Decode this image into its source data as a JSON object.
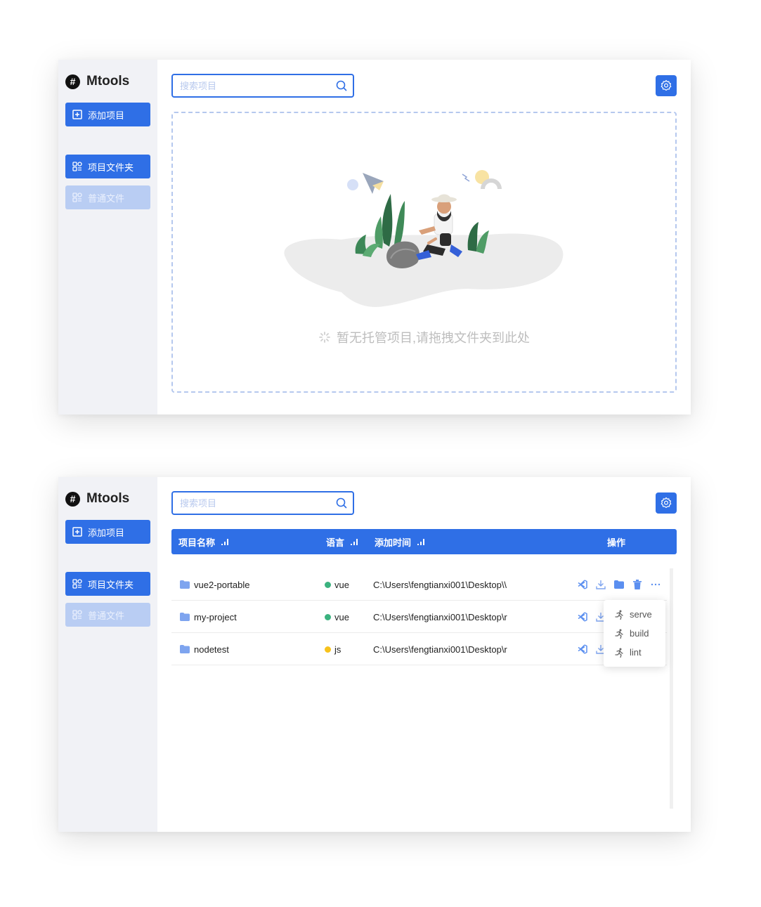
{
  "app": {
    "title": "Mtools",
    "add_project": "添加项目",
    "nav": {
      "project_folder": "项目文件夹",
      "normal_files": "普通文件"
    },
    "search_placeholder": "搜索项目"
  },
  "empty_state": {
    "message": "暂无托管项目,请拖拽文件夹到此处"
  },
  "table": {
    "headers": {
      "name": "项目名称",
      "lang": "语言",
      "time": "添加时间",
      "ops": "操作"
    },
    "rows": [
      {
        "name": "vue2-portable",
        "lang": "vue",
        "lang_color": "#3bb27f",
        "path": "C:\\Users\\fengtianxi001\\Desktop\\\\"
      },
      {
        "name": "my-project",
        "lang": "vue",
        "lang_color": "#3bb27f",
        "path": "C:\\Users\\fengtianxi001\\Desktop\\r"
      },
      {
        "name": "nodetest",
        "lang": "js",
        "lang_color": "#f7c21c",
        "path": "C:\\Users\\fengtianxi001\\Desktop\\r"
      }
    ]
  },
  "script_menu": {
    "items": [
      "serve",
      "build",
      "lint"
    ]
  },
  "icons": {
    "logo": "hash-icon",
    "add": "plus-square-icon",
    "nav": "grid-icon",
    "search": "search-icon",
    "settings": "gear-icon",
    "sort": "sort-bars-icon",
    "folder": "folder-icon",
    "vscode": "vscode-icon",
    "download": "download-icon",
    "open_folder": "folder-icon",
    "delete": "trash-icon",
    "more": "ellipsis-icon",
    "run": "run-icon",
    "loading": "spinner-icon"
  },
  "colors": {
    "primary": "#2f6fe6",
    "sidebar_bg": "#f1f2f6",
    "disabled_nav": "#b9cdf3",
    "vue": "#3bb27f",
    "js": "#f7c21c"
  }
}
